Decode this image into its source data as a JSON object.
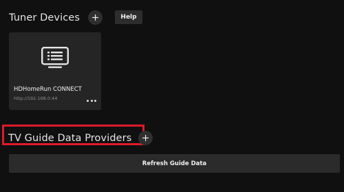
{
  "tuner_devices": {
    "title": "Tuner Devices",
    "add_icon": "plus-icon",
    "help_label": "Help"
  },
  "device": {
    "icon": "tv-guide-icon",
    "name": "HDHomeRun CONNECT",
    "url": "http://192.168.0.44",
    "menu_icon": "more-horizontal-icon"
  },
  "providers": {
    "title": "TV Guide Data Providers",
    "add_icon": "plus-icon",
    "highlight_color": "#e01a2b",
    "refresh_label": "Refresh Guide Data"
  },
  "colors": {
    "background": "#101010",
    "card": "#252525",
    "button": "#2d2d2d"
  }
}
